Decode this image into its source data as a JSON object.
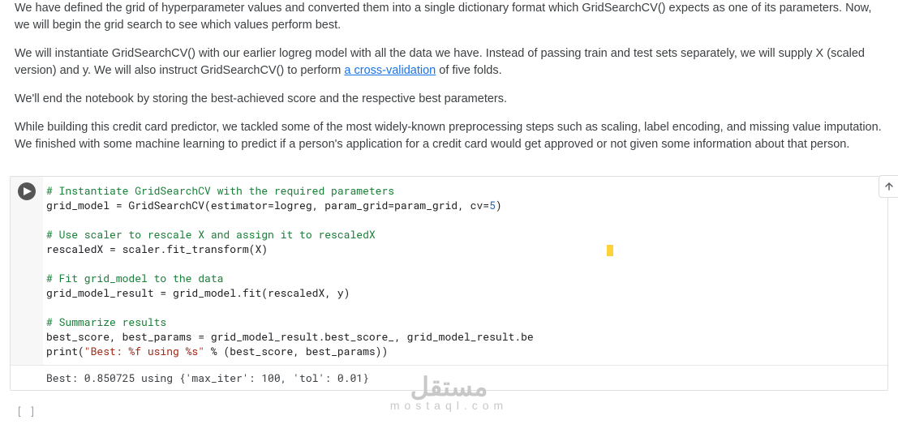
{
  "paragraphs": {
    "p0_a": "We have defined the grid of hyperparameter values and converted them into a single dictionary format which GridSearchCV() expects as one of its parameters. Now, we will begin the grid search to see which values perform best.",
    "p1_a": "We will instantiate GridSearchCV() with our earlier logreg model with all the data we have. Instead of passing train and test sets separately, we will supply X (scaled version) and y. We will also instruct GridSearchCV() to perform ",
    "p1_link": "a cross-validation",
    "p1_b": " of five folds.",
    "p2": "We'll end the notebook by storing the best-achieved score and the respective best parameters.",
    "p3": "While building this credit card predictor, we tackled some of the most widely-known preprocessing steps such as scaling, label encoding, and missing value imputation. We finished with some machine learning to predict if a person's application for a credit card would get approved or not given some information about that person."
  },
  "code": {
    "c1_comment": "# Instantiate GridSearchCV with the required parameters",
    "c2_a": "grid_model = GridSearchCV(estimator=logreg, param_grid=param_grid, cv=",
    "c2_num": "5",
    "c2_b": ")",
    "c3_blank": "",
    "c4_comment": "# Use scaler to rescale X and assign it to rescaledX",
    "c5": "rescaledX = scaler.fit_transform(X)",
    "c6_blank": "",
    "c7_comment": "# Fit grid_model to the data",
    "c8": "grid_model_result = grid_model.fit(rescaledX, y)",
    "c9_blank": "",
    "c10_comment": "# Summarize results",
    "c11": "best_score, best_params = grid_model_result.best_score_, grid_model_result.best_params_",
    "c12_a": "print(",
    "c12_str": "\"Best: %f using %s\"",
    "c12_b": " % (best_score, best_params))"
  },
  "output": "Best: 0.850725 using {'max_iter': 100, 'tol': 0.01}",
  "empty_prompt": "[ ]",
  "watermark": {
    "ar": "مستقل",
    "en": "mostaql.com"
  }
}
